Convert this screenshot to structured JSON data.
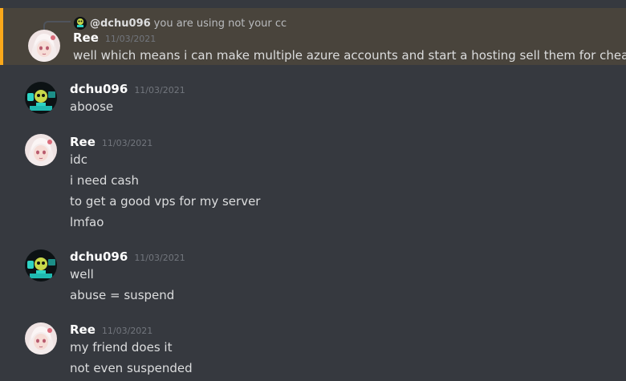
{
  "reply": {
    "author": "@dchu096",
    "text": "you are using not your cc"
  },
  "messages": [
    {
      "author": "Ree",
      "timestamp": "11/03/2021",
      "lines": [
        "well which means i can make multiple azure accounts and start a hosting sell them for cheap"
      ]
    },
    {
      "author": "dchu096",
      "timestamp": "11/03/2021",
      "lines": [
        "aboose"
      ]
    },
    {
      "author": "Ree",
      "timestamp": "11/03/2021",
      "lines": [
        "idc",
        "i need cash",
        "to get a good vps for my server",
        "lmfao"
      ]
    },
    {
      "author": "dchu096",
      "timestamp": "11/03/2021",
      "lines": [
        "well",
        "abuse = suspend"
      ]
    },
    {
      "author": "Ree",
      "timestamp": "11/03/2021",
      "lines": [
        "my friend does it",
        "not even suspended"
      ]
    }
  ],
  "colors": {
    "background": "#36393f",
    "mention_highlight": "#49443c",
    "mention_border": "#faa81a",
    "author": "#ffffff",
    "timestamp": "#72767d",
    "text": "#dcddde"
  }
}
